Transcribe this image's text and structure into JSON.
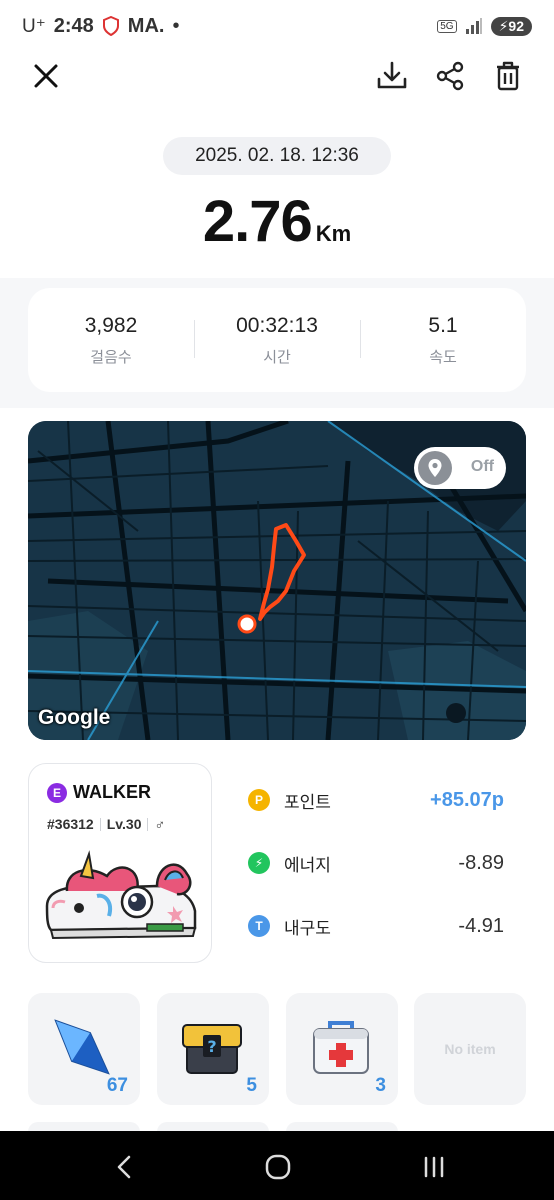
{
  "status_bar": {
    "carrier": "U⁺",
    "time": "2:48",
    "app_badge": "MA.",
    "dot": "•",
    "network": "5G",
    "battery": "92"
  },
  "toolbar": {
    "close_icon": "close-icon",
    "download_icon": "download-icon",
    "share_icon": "share-icon",
    "delete_icon": "trash-icon"
  },
  "record": {
    "datetime": "2025. 02. 18. 12:36",
    "distance": "2.76",
    "distance_unit": "Km"
  },
  "stats": [
    {
      "value": "3,982",
      "label": "걸음수"
    },
    {
      "value": "00:32:13",
      "label": "시간"
    },
    {
      "value": "5.1",
      "label": "속도"
    }
  ],
  "map": {
    "toggle_label": "Off",
    "attribution": "Google",
    "route_color": "#ff4a17",
    "map_bg": "#173447"
  },
  "walker": {
    "badge": "E",
    "name": "WALKER",
    "id": "#36312",
    "level": "Lv.30",
    "gender_symbol": "♂"
  },
  "rewards": [
    {
      "icon_letter": "P",
      "icon_color": "#f5b400",
      "label": "포인트",
      "value": "+85.07p"
    },
    {
      "icon_letter": "⚡",
      "icon_color": "#22c55e",
      "label": "에너지",
      "value": "-8.89"
    },
    {
      "icon_letter": "T",
      "icon_color": "#4a97e8",
      "label": "내구도",
      "value": "-4.91"
    }
  ],
  "items": [
    {
      "icon": "blue-gem-icon",
      "count": "67"
    },
    {
      "icon": "mystery-box-icon",
      "count": "5"
    },
    {
      "icon": "first-aid-kit-icon",
      "count": "3"
    },
    {
      "empty_label": "No item"
    }
  ],
  "nav": {
    "back_icon": "back-icon",
    "home_icon": "home-icon",
    "recents_icon": "recents-icon"
  }
}
